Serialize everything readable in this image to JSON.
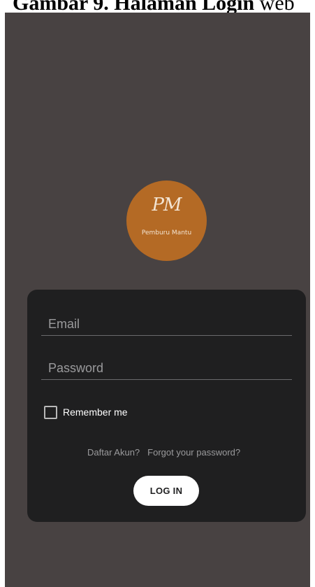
{
  "caption": {
    "prefix": "Gambar 9. Halaman Login",
    "suffix": " web"
  },
  "logo": {
    "mark": "PM",
    "name": "Pemburu Mantu"
  },
  "form": {
    "email": {
      "placeholder": "Email",
      "value": ""
    },
    "password": {
      "placeholder": "Password",
      "value": ""
    },
    "remember_label": "Remember me",
    "remember_checked": false,
    "register_link": "Daftar Akun?",
    "forgot_link": "Forgot your password?",
    "login_label": "LOG IN"
  },
  "colors": {
    "screen_bg": "#484242",
    "card_bg": "#1f1f20",
    "logo_bg": "#b46a25",
    "button_bg": "#ffffff"
  }
}
